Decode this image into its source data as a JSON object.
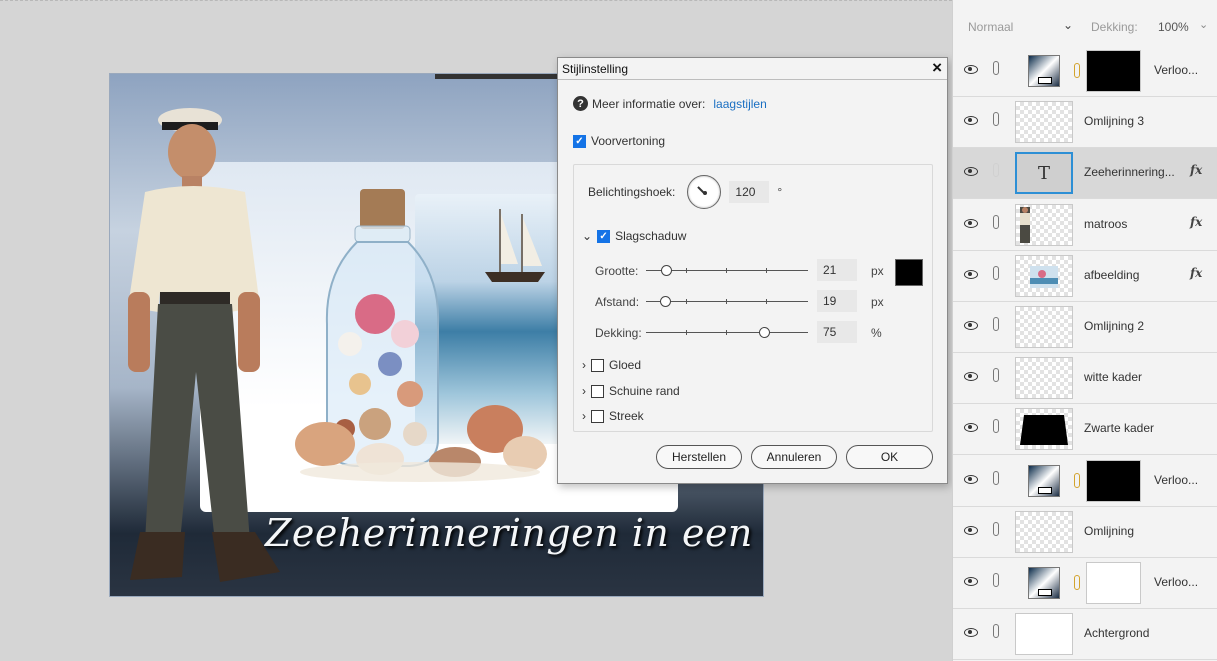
{
  "dialog": {
    "title": "Stijlinstelling",
    "info_label": "Meer informatie over:",
    "info_link": "laagstijlen",
    "preview_label": "Voorvertoning",
    "angle_label": "Belichtingshoek:",
    "angle_value": "120",
    "angle_unit": "°",
    "drop_shadow_label": "Slagschaduw",
    "size_label": "Grootte:",
    "size_value": "21",
    "size_unit": "px",
    "size_level": 0.1,
    "distance_label": "Afstand:",
    "distance_value": "19",
    "distance_unit": "px",
    "distance_level": 0.09,
    "opacity_label": "Dekking:",
    "opacity_value": "75",
    "opacity_unit": "%",
    "opacity_level": 0.75,
    "shadow_color": "#000000",
    "glow_label": "Gloed",
    "bevel_label": "Schuine rand",
    "stroke_label": "Streek",
    "reset_button": "Herstellen",
    "cancel_button": "Annuleren",
    "ok_button": "OK"
  },
  "canvas": {
    "caption": "Zeeherinneringen in een fles"
  },
  "layers_panel": {
    "blend_mode": "Normaal",
    "opacity_label": "Dekking:",
    "opacity_value": "100%",
    "layers": [
      {
        "name": "Verloo...",
        "thumb": "gradient-fill",
        "has_mask": true,
        "mask": "black",
        "fx": false,
        "selected": false
      },
      {
        "name": "Omlijning 3",
        "thumb": "transparent",
        "fx": false,
        "selected": false
      },
      {
        "name": "Zeeherinnering...",
        "thumb": "text",
        "fx": true,
        "selected": true
      },
      {
        "name": "matroos",
        "thumb": "image",
        "fx": true,
        "selected": false
      },
      {
        "name": "afbeelding",
        "thumb": "image",
        "fx": true,
        "selected": false
      },
      {
        "name": "Omlijning 2",
        "thumb": "transparent",
        "fx": false,
        "selected": false
      },
      {
        "name": "witte kader",
        "thumb": "transparent",
        "fx": false,
        "selected": false
      },
      {
        "name": "Zwarte kader",
        "thumb": "black-shape",
        "fx": false,
        "selected": false
      },
      {
        "name": "Verloo...",
        "thumb": "gradient-fill",
        "has_mask": true,
        "mask": "black",
        "fx": false,
        "selected": false
      },
      {
        "name": "Omlijning",
        "thumb": "transparent",
        "fx": false,
        "selected": false
      },
      {
        "name": "Verloo...",
        "thumb": "gradient-fill",
        "has_mask": true,
        "mask": "white",
        "fx": false,
        "selected": false
      },
      {
        "name": "Achtergrond",
        "thumb": "white",
        "fx": false,
        "selected": false
      }
    ]
  },
  "icons": {
    "visibility": "eye-icon",
    "link": "link-icon",
    "effects": "fx-icon",
    "text_layer": "T"
  },
  "colors": {
    "accent": "#1473e6",
    "link": "#1a6fc2",
    "mask_chain": "#d3a32c"
  }
}
